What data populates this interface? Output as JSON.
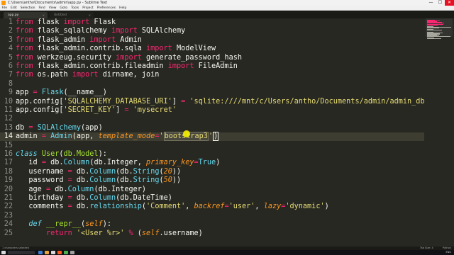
{
  "window": {
    "title": "C:\\Users\\antho\\Documents\\admin\\app.py - Sublime Text",
    "minimize": "—",
    "maximize": "☐",
    "close": "✕"
  },
  "menu": [
    "File",
    "Edit",
    "Selection",
    "Find",
    "View",
    "Goto",
    "Tools",
    "Project",
    "Preferences",
    "Help"
  ],
  "tabs": [
    {
      "label": "app.py",
      "active": true
    },
    {
      "label": "Untitled",
      "active": false
    }
  ],
  "tab_close": "×",
  "editor": {
    "current_line": 14,
    "lines": [
      {
        "n": 1,
        "tokens": [
          [
            "kw",
            "from"
          ],
          [
            "",
            "  flask "
          ],
          [
            "kw",
            "import"
          ],
          [
            "",
            " Flask"
          ]
        ]
      },
      {
        "n": 2,
        "tokens": [
          [
            "kw",
            "from"
          ],
          [
            "",
            ""
          ],
          [
            "",
            "  flask_sqlalchemy "
          ],
          [
            "kw",
            "import"
          ],
          [
            "",
            " SQLAlchemy"
          ]
        ]
      },
      {
        "n": 3,
        "tokens": [
          [
            "kw",
            "from"
          ],
          [
            "",
            "  flask_admin "
          ],
          [
            "kw",
            "import"
          ],
          [
            "",
            " Admin"
          ]
        ]
      },
      {
        "n": 4,
        "tokens": [
          [
            "kw",
            "from"
          ],
          [
            "",
            "  flask_admin.contrib.sqla "
          ],
          [
            "kw",
            "import"
          ],
          [
            "",
            " ModelView"
          ]
        ]
      },
      {
        "n": 5,
        "tokens": [
          [
            "kw",
            "from"
          ],
          [
            "",
            "  werkzeug.security "
          ],
          [
            "kw",
            "import"
          ],
          [
            "",
            " generate_password_hash"
          ]
        ]
      },
      {
        "n": 6,
        "tokens": [
          [
            "kw",
            "from"
          ],
          [
            "",
            "  flask_admin.contrib.fileadmin "
          ],
          [
            "kw",
            "import"
          ],
          [
            "",
            " FileAdmin"
          ]
        ]
      },
      {
        "n": 7,
        "tokens": [
          [
            "kw",
            "from"
          ],
          [
            "",
            "  os.path "
          ],
          [
            "kw",
            "import"
          ],
          [
            "",
            " dirname, join"
          ]
        ]
      },
      {
        "n": 8,
        "tokens": []
      },
      {
        "n": 9,
        "tokens": [
          [
            "",
            "app "
          ],
          [
            "kw",
            "="
          ],
          [
            "",
            " "
          ],
          [
            "bi",
            "Flask"
          ],
          [
            "",
            "(__name__)"
          ]
        ]
      },
      {
        "n": 10,
        "tokens": [
          [
            "",
            "app.config["
          ],
          [
            "st",
            "'SQLALCHEMY_DATABASE_URI'"
          ],
          [
            "",
            "] "
          ],
          [
            "kw",
            "="
          ],
          [
            "",
            " "
          ],
          [
            "st",
            "'sqlite:////mnt/c/Users/antho/Documents/admin/admin_db.db'"
          ]
        ]
      },
      {
        "n": 11,
        "tokens": [
          [
            "",
            "app.config["
          ],
          [
            "st",
            "'SECRET_KEY'"
          ],
          [
            "",
            "] "
          ],
          [
            "kw",
            "="
          ],
          [
            "",
            " "
          ],
          [
            "st",
            "'mysecret'"
          ]
        ]
      },
      {
        "n": 12,
        "tokens": []
      },
      {
        "n": 13,
        "tokens": [
          [
            "",
            "db "
          ],
          [
            "kw",
            "="
          ],
          [
            "",
            " "
          ],
          [
            "bi",
            "SQLAlchemy"
          ],
          [
            "",
            "(app)"
          ]
        ]
      },
      {
        "n": 14,
        "tokens": [
          [
            "",
            "admin "
          ],
          [
            "kw",
            "="
          ],
          [
            "",
            " "
          ],
          [
            "bi",
            "Admin"
          ],
          [
            "",
            "(app, "
          ],
          [
            "ar",
            "template_mode"
          ],
          [
            "kw",
            "="
          ],
          [
            "st",
            "'"
          ],
          [
            "sel-st",
            "bootstrap3"
          ],
          [
            "st",
            "'"
          ],
          [
            "brk",
            ")"
          ]
        ]
      },
      {
        "n": 15,
        "tokens": []
      },
      {
        "n": 16,
        "tokens": [
          [
            "cls",
            "class"
          ],
          [
            "",
            " "
          ],
          [
            "fn",
            "User"
          ],
          [
            "",
            "("
          ],
          [
            "fn",
            "db.Model"
          ],
          [
            "",
            "):"
          ]
        ]
      },
      {
        "n": 17,
        "tokens": [
          [
            "",
            "    id "
          ],
          [
            "kw",
            "="
          ],
          [
            "",
            " db."
          ],
          [
            "bi",
            "Column"
          ],
          [
            "",
            "(db.Integer, "
          ],
          [
            "ar",
            "primary_key"
          ],
          [
            "kw",
            "="
          ],
          [
            "bi",
            "True"
          ],
          [
            "",
            ")"
          ]
        ]
      },
      {
        "n": 18,
        "tokens": [
          [
            "",
            "    username "
          ],
          [
            "kw",
            "="
          ],
          [
            "",
            " db."
          ],
          [
            "bi",
            "Column"
          ],
          [
            "",
            "(db."
          ],
          [
            "bi",
            "String"
          ],
          [
            "",
            "("
          ],
          [
            "sf",
            "20"
          ],
          [
            "",
            "))"
          ]
        ]
      },
      {
        "n": 19,
        "tokens": [
          [
            "",
            "    password "
          ],
          [
            "kw",
            "="
          ],
          [
            "",
            " db."
          ],
          [
            "bi",
            "Column"
          ],
          [
            "",
            "(db."
          ],
          [
            "bi",
            "String"
          ],
          [
            "",
            "("
          ],
          [
            "sf",
            "50"
          ],
          [
            "",
            "))"
          ]
        ]
      },
      {
        "n": 20,
        "tokens": [
          [
            "",
            "    age "
          ],
          [
            "kw",
            "="
          ],
          [
            "",
            " db."
          ],
          [
            "bi",
            "Column"
          ],
          [
            "",
            "(db.Integer)"
          ]
        ]
      },
      {
        "n": 21,
        "tokens": [
          [
            "",
            "    birthday "
          ],
          [
            "kw",
            "="
          ],
          [
            "",
            " db."
          ],
          [
            "bi",
            "Column"
          ],
          [
            "",
            "(db.DateTime)"
          ]
        ]
      },
      {
        "n": 22,
        "tokens": [
          [
            "",
            "    comments "
          ],
          [
            "kw",
            "="
          ],
          [
            "",
            " db."
          ],
          [
            "bi",
            "relationship"
          ],
          [
            "",
            "("
          ],
          [
            "st",
            "'Comment'"
          ],
          [
            "",
            ", "
          ],
          [
            "ar",
            "backref"
          ],
          [
            "kw",
            "="
          ],
          [
            "st",
            "'user'"
          ],
          [
            "",
            ", "
          ],
          [
            "ar",
            "lazy"
          ],
          [
            "kw",
            "="
          ],
          [
            "st",
            "'dynamic'"
          ],
          [
            "",
            ")"
          ]
        ]
      },
      {
        "n": 23,
        "tokens": []
      },
      {
        "n": 24,
        "tokens": [
          [
            "",
            "    "
          ],
          [
            "cls",
            "def"
          ],
          [
            "",
            " "
          ],
          [
            "fn",
            "__repr__"
          ],
          [
            "",
            "("
          ],
          [
            "sf",
            "self"
          ],
          [
            "",
            "):"
          ]
        ]
      },
      {
        "n": 25,
        "tokens": [
          [
            "",
            "        "
          ],
          [
            "kw",
            "return"
          ],
          [
            "",
            " "
          ],
          [
            "st",
            "'<User %r>'"
          ],
          [
            "",
            " "
          ],
          [
            "kw",
            "%"
          ],
          [
            "",
            " ("
          ],
          [
            "sf",
            "self"
          ],
          [
            "",
            ".username)"
          ]
        ]
      }
    ]
  },
  "statusbar": {
    "left": "1 characters selected",
    "tab_size": "Tab Size: 4",
    "syntax": "Python"
  },
  "taskbar": {
    "search_placeholder": "",
    "tray": "ENG"
  },
  "colors": {
    "background": "#272822",
    "keyword": "#f92672",
    "string": "#e6db74",
    "function": "#a6e22e",
    "builtin": "#66d9ef",
    "argument": "#fd971f"
  }
}
